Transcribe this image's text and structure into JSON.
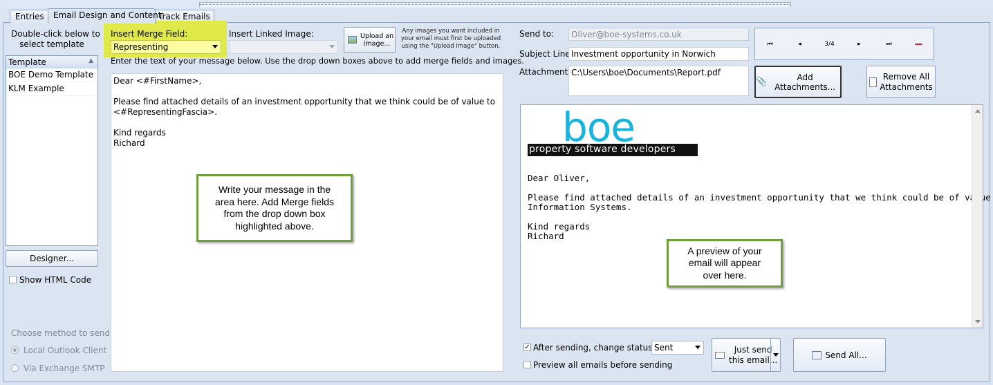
{
  "tabs": [
    "Entries",
    "Email Design and Content",
    "Track Emails"
  ],
  "left": {
    "instruction": [
      "Double-click below to",
      "select template"
    ],
    "list_header": "Template",
    "templates": [
      "BOE Demo Template",
      "KLM Example"
    ],
    "designer_label": "Designer...",
    "show_html_label": "Show HTML Code",
    "method_label": "Choose method to send",
    "method_options": [
      "Local Outlook Client",
      "Via Exchange SMTP"
    ]
  },
  "merge": {
    "label": "Insert Merge Field:",
    "value": "Representing",
    "highlight_color": "#e0e94a"
  },
  "linked_image": {
    "label": "Insert Linked Image:",
    "value": ""
  },
  "upload": {
    "label": [
      "Upload an",
      "image..."
    ],
    "note": [
      "Any images you want included in",
      "your email must first be uploaded",
      "using the \"Upload Image\" button."
    ]
  },
  "editor": {
    "instruction": "Enter the text of your message below. Use the drop down boxes above to add merge fields and images.",
    "lines": [
      "Dear <#FirstName>,",
      "",
      "Please find attached details of an investment opportunity that we think could be of value to",
      "<#RepresentingFascia>.",
      "",
      "Kind regards",
      "Richard"
    ]
  },
  "callout_left": [
    "Write your message in the",
    "area here. Add Merge fields",
    "from the drop down box",
    "highlighted above."
  ],
  "email": {
    "send_to_label": "Send to:",
    "send_to_value": "Oliver@boe-systems.co.uk",
    "subject_label": "Subject Line:",
    "subject_value": "Investment opportunity in Norwich",
    "attachments_label": "Attachments:",
    "attachments_value": "C:\\Users\\boe\\Documents\\Report.pdf",
    "add_attachments_label": "Add Attachments...",
    "remove_all_label": [
      "Remove All",
      "Attachments"
    ]
  },
  "navigator": {
    "buttons": [
      "⏮",
      "◂",
      "3/4",
      "▸",
      "⏭",
      "−"
    ],
    "remove_color": "#d0021b"
  },
  "preview": {
    "logo_word": "boe",
    "logo_tagline": "property software developers",
    "logo_color": "#19b4dc",
    "lines": [
      "Dear Oliver,",
      "Please find attached details of an investment opportunity that we think could be of value to BOE",
      "Information Systems.",
      "Kind regards",
      "Richard"
    ]
  },
  "callout_right": [
    "A preview of your",
    "email will appear",
    "over here."
  ],
  "bottom": {
    "after_sending_label": "After sending, change status to",
    "status_value": "Sent",
    "preview_all_label": "Preview all emails before sending",
    "just_send_label": [
      "Just send",
      "this email..."
    ],
    "send_all_label": "Send All..."
  },
  "callout_border_color": "#6f9e3a"
}
